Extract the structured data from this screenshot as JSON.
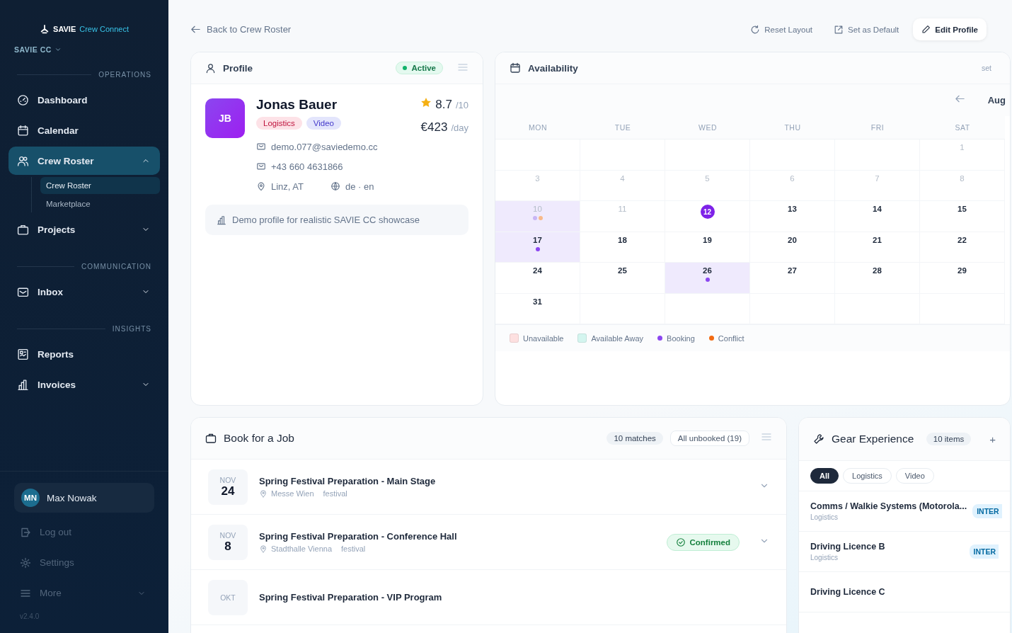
{
  "brand": {
    "name": "SAVIE",
    "product": "Crew Connect"
  },
  "org": {
    "label": "SAVIE CC"
  },
  "nav": [
    {
      "kind": "section",
      "label": "OPERATIONS"
    },
    {
      "kind": "item",
      "label": "Dashboard",
      "selected": false
    },
    {
      "kind": "item",
      "label": "Calendar",
      "selected": false
    },
    {
      "kind": "group",
      "label": "Crew Roster",
      "selected": true,
      "expanded": true,
      "children": [
        {
          "label": "Crew Roster",
          "selected": true
        },
        {
          "label": "Marketplace",
          "selected": false
        }
      ]
    },
    {
      "kind": "group",
      "label": "Projects",
      "selected": false,
      "expanded": false
    },
    {
      "kind": "section",
      "label": "COMMUNICATION"
    },
    {
      "kind": "group",
      "label": "Inbox",
      "selected": false,
      "expanded": false
    },
    {
      "kind": "section",
      "label": "INSIGHTS"
    },
    {
      "kind": "item",
      "label": "Reports",
      "selected": false
    },
    {
      "kind": "group",
      "label": "Invoices",
      "selected": false,
      "expanded": false
    }
  ],
  "user": {
    "initials": "MN",
    "name": "Max Nowak"
  },
  "footer_items": [
    {
      "kind": "item",
      "label": "Log out"
    },
    {
      "kind": "item",
      "label": "Settings"
    },
    {
      "kind": "group",
      "label": "More"
    }
  ],
  "version": "v2.4.0",
  "back_link": "Back to Crew Roster",
  "toolbar": [
    {
      "kind": "plain",
      "label": "Reset Layout"
    },
    {
      "kind": "plain",
      "label": "Set as Default"
    },
    {
      "kind": "primary",
      "label": "Edit Profile"
    }
  ],
  "profile": {
    "title": "Profile",
    "status": "Active",
    "initials": "JB",
    "name": "Jonas Bauer",
    "tags": [
      {
        "label": "Logistics",
        "color": "#fde2e7"
      },
      {
        "label": "Video",
        "color": "#e3e5fc"
      }
    ],
    "rating": "8.7",
    "rating_max": "/10",
    "rate": "€423",
    "rate_unit": "/day",
    "email": "demo.077@saviedemo.cc",
    "phone": "+43 660 4631866",
    "location": "Linz, AT",
    "languages": "de · en",
    "note": "Demo profile for realistic SAVIE CC showcase"
  },
  "availability": {
    "title": "Availability",
    "header_link": "set",
    "month": "Aug",
    "weekdays": [
      "MON",
      "TUE",
      "WED",
      "THU",
      "FRI",
      "SAT"
    ],
    "weeks": [
      [
        {
          "day": "1",
          "muted": true,
          "highlight": false,
          "today": false
        }
      ],
      [
        {
          "day": "3",
          "muted": true,
          "highlight": false,
          "today": false
        },
        {
          "day": "4",
          "muted": true,
          "highlight": false,
          "today": false
        },
        {
          "day": "5",
          "muted": true,
          "highlight": false,
          "today": false
        },
        {
          "day": "6",
          "muted": true,
          "highlight": false,
          "today": false
        },
        {
          "day": "7",
          "muted": true,
          "highlight": false,
          "today": false
        },
        {
          "day": "8",
          "muted": true,
          "highlight": false,
          "today": false
        }
      ],
      [
        {
          "day": "10",
          "muted": true,
          "highlight": true,
          "today": false,
          "dots": [
            {
              "color": "#c8b5f5"
            },
            {
              "color": "#f8b98a"
            }
          ]
        },
        {
          "day": "11",
          "muted": true,
          "highlight": false,
          "today": false
        },
        {
          "day": "12",
          "muted": false,
          "highlight": false,
          "today": true
        },
        {
          "day": "13",
          "muted": false,
          "highlight": false,
          "today": false
        },
        {
          "day": "14",
          "muted": false,
          "highlight": false,
          "today": false
        },
        {
          "day": "15",
          "muted": false,
          "highlight": false,
          "today": false
        }
      ],
      [
        {
          "day": "17",
          "muted": false,
          "highlight": true,
          "today": false,
          "dots": [
            {
              "color": "#8b46f0"
            }
          ]
        },
        {
          "day": "18",
          "muted": false,
          "highlight": false,
          "today": false
        },
        {
          "day": "19",
          "muted": false,
          "highlight": false,
          "today": false
        },
        {
          "day": "20",
          "muted": false,
          "highlight": false,
          "today": false
        },
        {
          "day": "21",
          "muted": false,
          "highlight": false,
          "today": false
        },
        {
          "day": "22",
          "muted": false,
          "highlight": false,
          "today": false
        }
      ],
      [
        {
          "day": "24",
          "muted": false,
          "highlight": false,
          "today": false
        },
        {
          "day": "25",
          "muted": false,
          "highlight": false,
          "today": false
        },
        {
          "day": "26",
          "muted": false,
          "highlight": true,
          "today": false,
          "dots": [
            {
              "color": "#8b46f0"
            }
          ]
        },
        {
          "day": "27",
          "muted": false,
          "highlight": false,
          "today": false
        },
        {
          "day": "28",
          "muted": false,
          "highlight": false,
          "today": false
        },
        {
          "day": "29",
          "muted": false,
          "highlight": false,
          "today": false
        }
      ],
      [
        {
          "day": "31",
          "muted": false,
          "highlight": false,
          "today": false
        }
      ]
    ],
    "legend": [
      {
        "kind": "swatch",
        "label": "Unavailable",
        "color": "#fde0e0"
      },
      {
        "kind": "swatch",
        "label": "Available Away",
        "color": "#d4f5ef"
      },
      {
        "kind": "dot",
        "label": "Booking",
        "color": "#8b46f0"
      },
      {
        "kind": "dot",
        "label": "Conflict",
        "color": "#f26a12"
      }
    ]
  },
  "jobs": {
    "title": "Book for a Job",
    "count": "10 matches",
    "filter": "All unbooked (19)",
    "items": [
      {
        "month": "NOV",
        "day": "24",
        "title": "Spring Festival Preparation - Main Stage",
        "venue": "Messe Wien",
        "category": "festival"
      },
      {
        "month": "NOV",
        "day": "8",
        "title": "Spring Festival Preparation - Conference Hall",
        "venue": "Stadthalle Vienna",
        "category": "festival",
        "status": "Confirmed"
      },
      {
        "month": "OKT",
        "title": "Spring Festival Preparation - VIP Program"
      }
    ]
  },
  "gear": {
    "title": "Gear Experience",
    "count": "10 items",
    "add": "+",
    "filters": [
      {
        "label": "All",
        "selected": true
      },
      {
        "label": "Logistics",
        "selected": false
      },
      {
        "label": "Video",
        "selected": false
      }
    ],
    "items": [
      {
        "name": "Comms / Walkie Systems (Motorola...",
        "category": "Logistics",
        "level": "INTER"
      },
      {
        "name": "Driving Licence B",
        "category": "Logistics",
        "level": "INTER"
      },
      {
        "name": "Driving Licence C"
      }
    ]
  }
}
